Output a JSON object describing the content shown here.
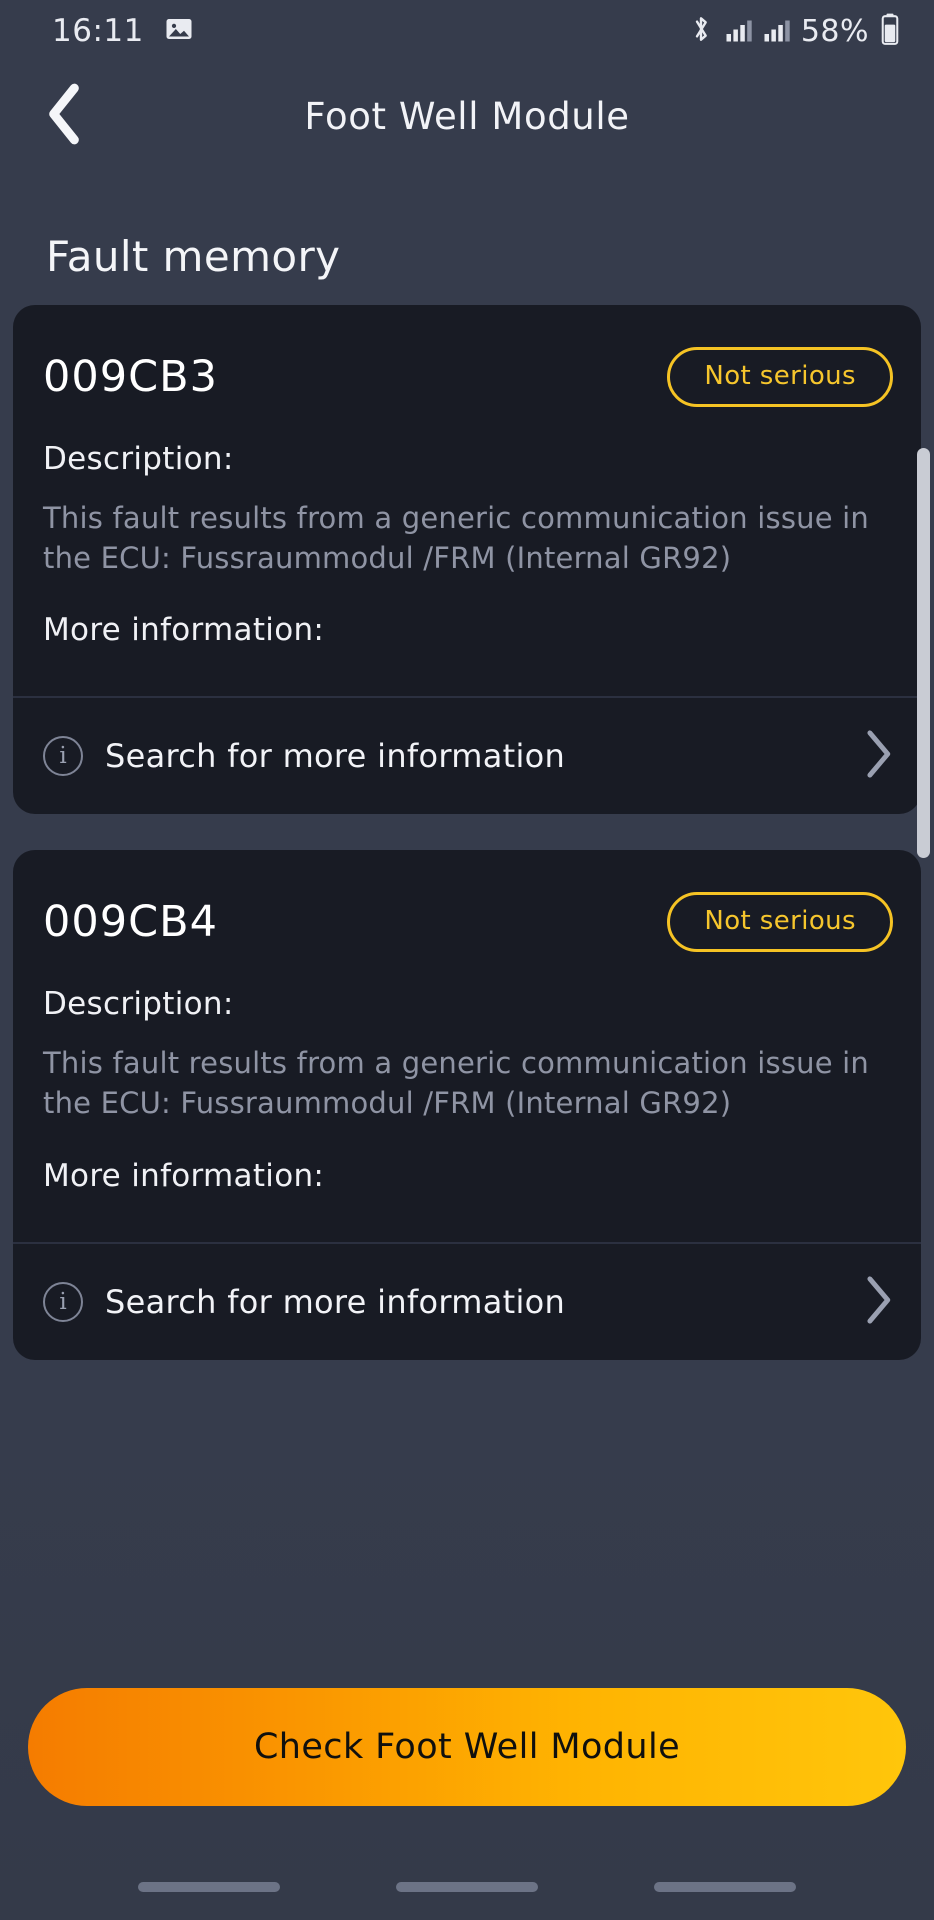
{
  "status_bar": {
    "time": "16:11",
    "battery_percent": "58%",
    "icons": [
      "image-icon",
      "bluetooth-icon",
      "signal-bars-icon",
      "signal-bars-icon",
      "battery-icon"
    ]
  },
  "nav": {
    "back_icon": "chevron-left-icon",
    "title": "Foot Well Module"
  },
  "section": {
    "title": "Fault memory"
  },
  "labels": {
    "description": "Description:",
    "more_information": "More information:",
    "search_link": "Search for more information",
    "info_icon": "info-circle-icon",
    "chevron_icon": "chevron-right-icon"
  },
  "faults": [
    {
      "code": "009CB3",
      "severity": "Not serious",
      "description": "This fault results from a generic communication issue in the ECU: Fussraummodul /FRM (Internal GR92)"
    },
    {
      "code": "009CB4",
      "severity": "Not serious",
      "description": "This fault results from a generic communication issue in the ECU: Fussraummodul /FRM (Internal GR92)"
    }
  ],
  "cta": {
    "label": "Check Foot Well Module"
  },
  "colors": {
    "background": "#363c4c",
    "card": "#181b24",
    "badge": "#f5c324",
    "cta_start": "#f57c00",
    "cta_end": "#ffc60b",
    "muted_text": "#8f94a4"
  }
}
